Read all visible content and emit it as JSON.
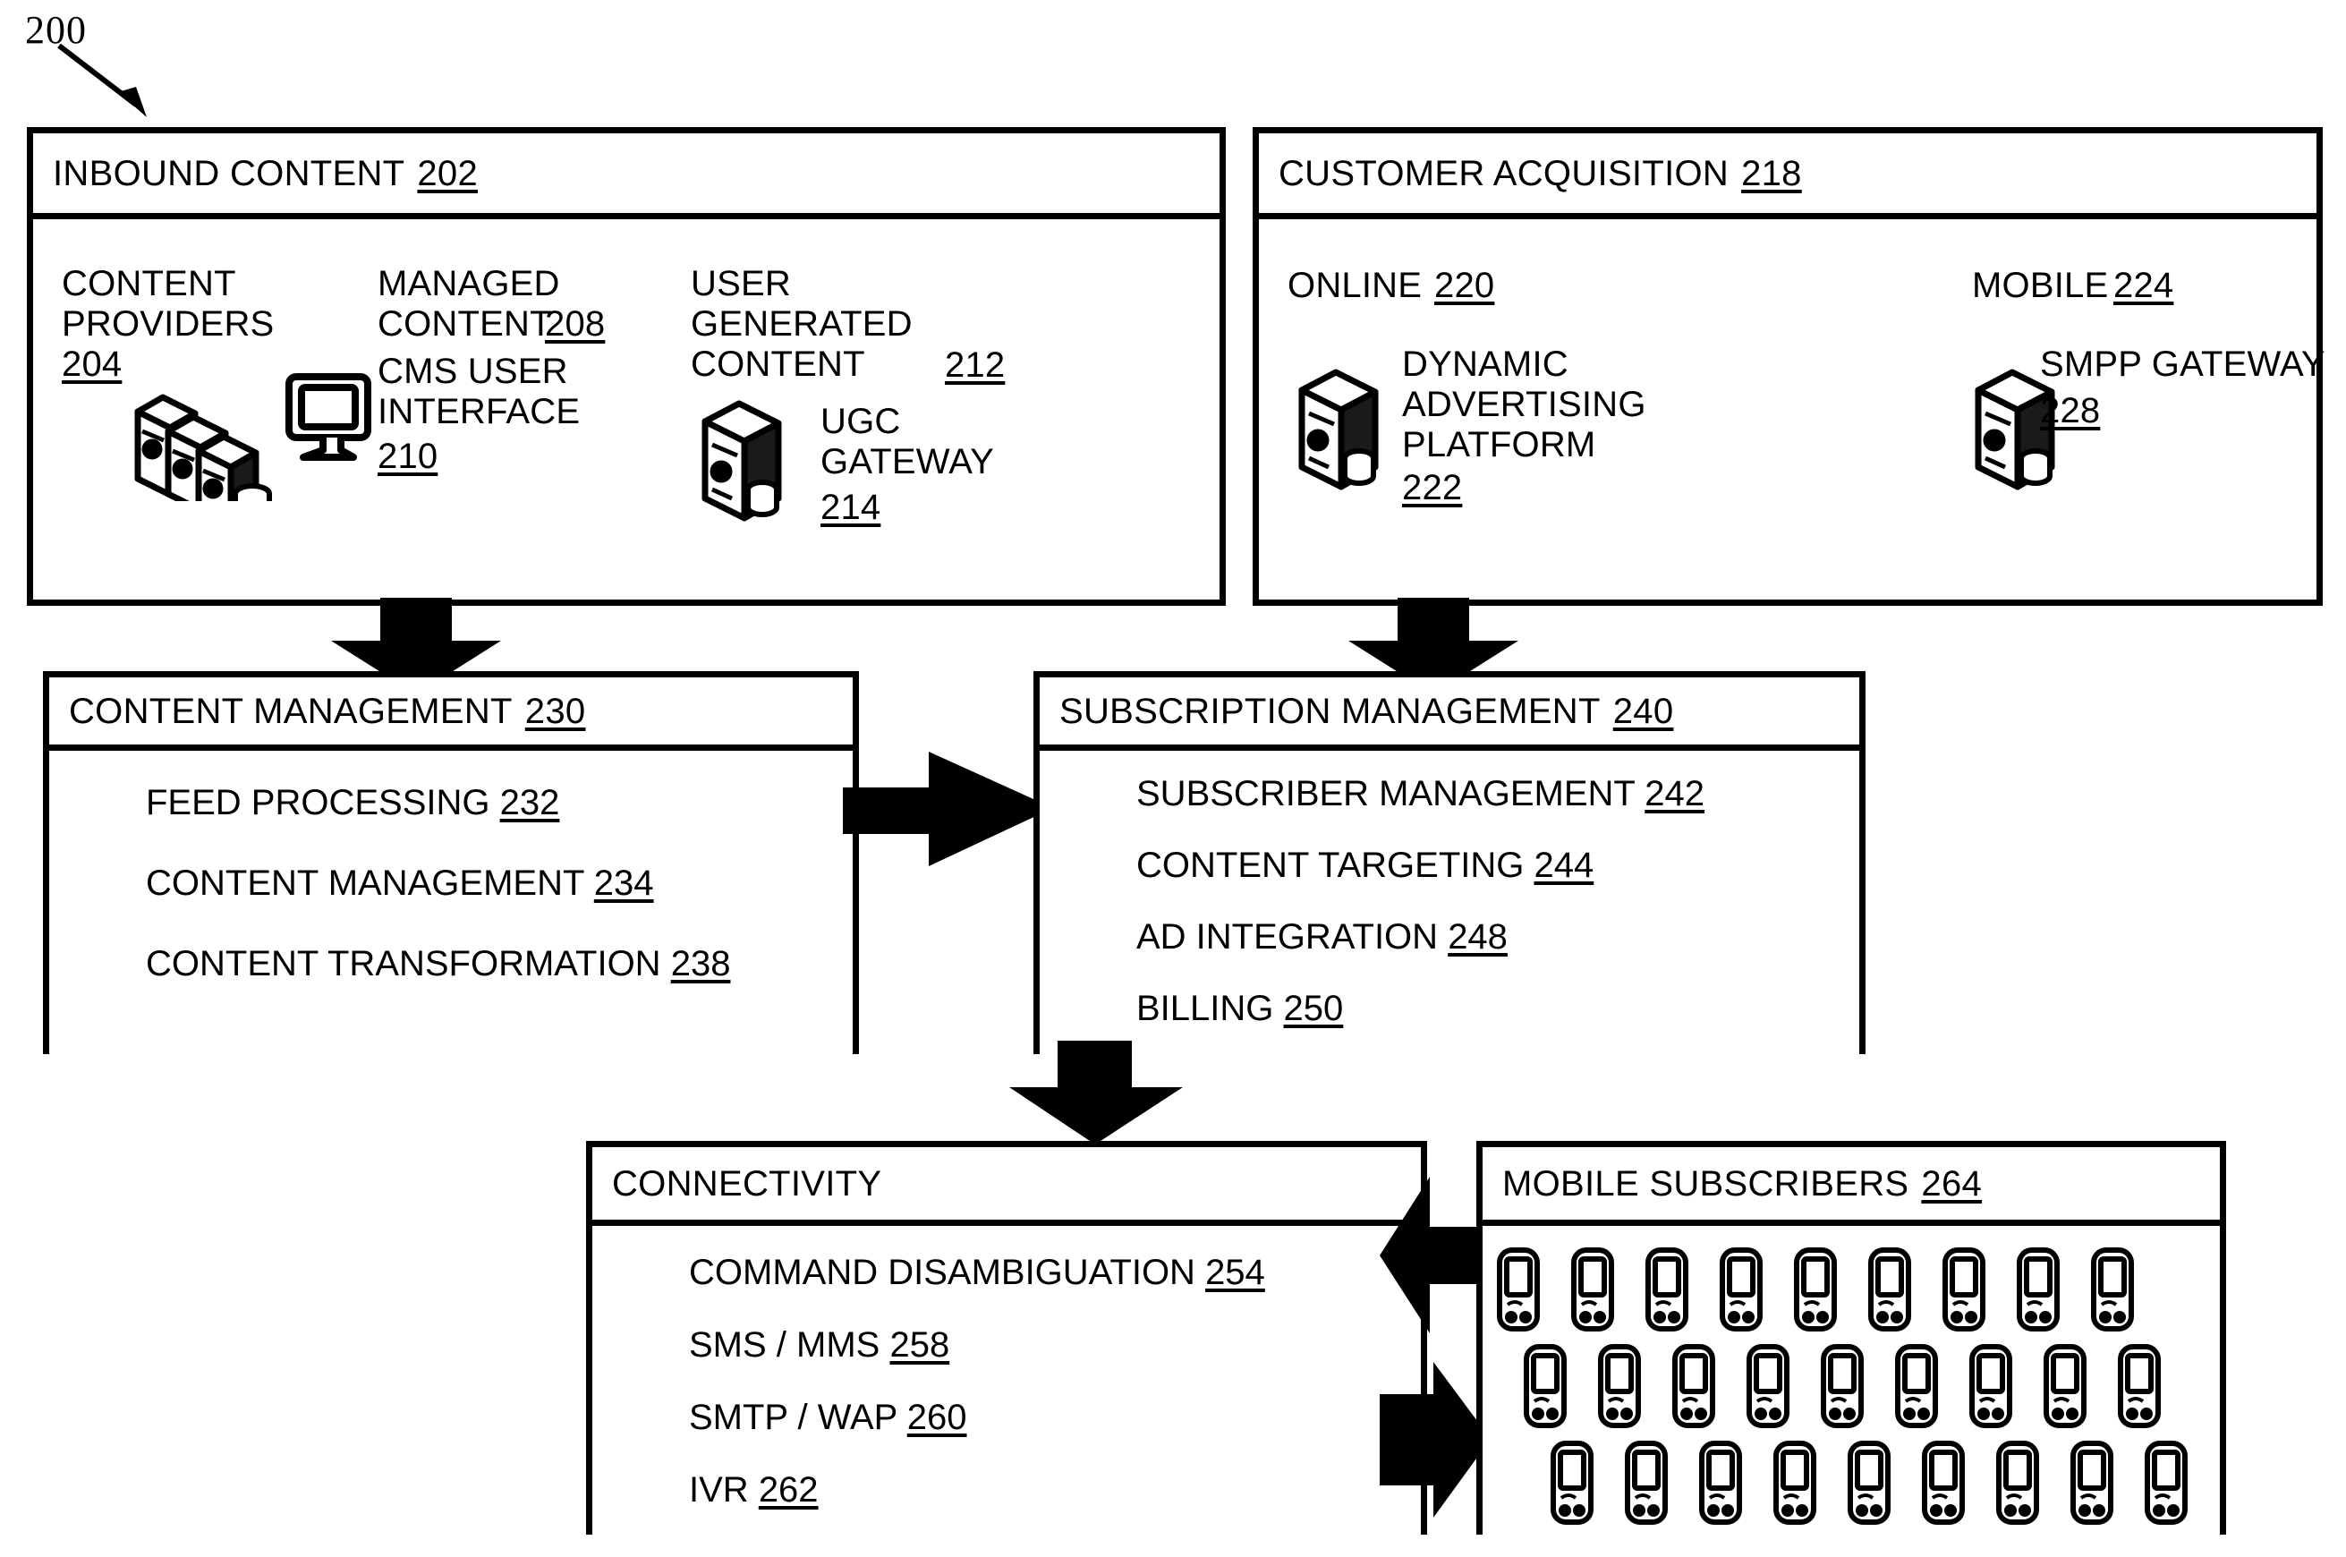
{
  "figure": {
    "callout_number": "200"
  },
  "boxes": {
    "inbound_content": {
      "title": "INBOUND CONTENT",
      "number": "202",
      "items": [
        {
          "label": "CONTENT\nPROVIDERS",
          "number": "204",
          "icon": "servers-icon"
        },
        {
          "label": "MANAGED\nCONTENT",
          "number": "208",
          "icon": ""
        },
        {
          "label": "CMS USER\nINTERFACE",
          "number": "210",
          "icon": "monitor-icon"
        },
        {
          "label": "USER\nGENERATED\nCONTENT",
          "number": "212",
          "icon": ""
        },
        {
          "label": "UGC\nGATEWAY",
          "number": "214",
          "icon": "server-icon"
        }
      ]
    },
    "customer_acquisition": {
      "title": "CUSTOMER ACQUISITION",
      "number": "218",
      "items": [
        {
          "label": "ONLINE",
          "number": "220",
          "icon": ""
        },
        {
          "label": "MOBILE",
          "number": "224",
          "icon": ""
        },
        {
          "label": "DYNAMIC\nADVERTISING\nPLATFORM",
          "number": "222",
          "icon": "server-icon"
        },
        {
          "label": "SMPP GATEWAY",
          "number": "228",
          "icon": "server-icon"
        }
      ]
    },
    "content_management": {
      "title": "CONTENT MANAGEMENT",
      "number": "230",
      "items": [
        {
          "label": "FEED PROCESSING",
          "number": "232"
        },
        {
          "label": "CONTENT MANAGEMENT",
          "number": "234"
        },
        {
          "label": "CONTENT TRANSFORMATION",
          "number": "238"
        }
      ]
    },
    "subscription_management": {
      "title": "SUBSCRIPTION MANAGEMENT",
      "number": "240",
      "items": [
        {
          "label": "SUBSCRIBER MANAGEMENT",
          "number": "242"
        },
        {
          "label": "CONTENT TARGETING",
          "number": "244"
        },
        {
          "label": "AD INTEGRATION",
          "number": "248"
        },
        {
          "label": "BILLING",
          "number": "250"
        }
      ]
    },
    "connectivity": {
      "title": "CONNECTIVITY",
      "number": "",
      "items": [
        {
          "label": "COMMAND DISAMBIGUATION",
          "number": "254"
        },
        {
          "label": "SMS / MMS",
          "number": "258"
        },
        {
          "label": "SMTP / WAP",
          "number": "260"
        },
        {
          "label": "IVR",
          "number": "262"
        }
      ]
    },
    "mobile_subscribers": {
      "title": "MOBILE SUBSCRIBERS",
      "number": "264",
      "phone_rows": [
        9,
        9,
        9
      ]
    }
  },
  "arrows": [
    {
      "name": "inbound-to-content-management",
      "direction": "down"
    },
    {
      "name": "customer-acquisition-to-subscription-management",
      "direction": "down"
    },
    {
      "name": "content-management-to-subscription-management",
      "direction": "right"
    },
    {
      "name": "subscription-management-to-connectivity",
      "direction": "down"
    },
    {
      "name": "mobile-subscribers-to-connectivity",
      "direction": "left"
    },
    {
      "name": "connectivity-to-mobile-subscribers",
      "direction": "right"
    }
  ],
  "colors": {
    "ink": "#000000",
    "paper": "#ffffff"
  }
}
